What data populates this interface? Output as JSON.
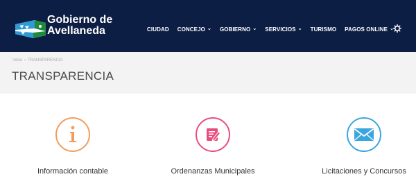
{
  "logo": {
    "line1": "Gobierno de",
    "line2": "Avellaneda"
  },
  "nav": {
    "items": [
      {
        "label": "CIUDAD",
        "dropdown": false
      },
      {
        "label": "CONCEJO",
        "dropdown": true
      },
      {
        "label": "GOBIERNO",
        "dropdown": true
      },
      {
        "label": "SERVICIOS",
        "dropdown": true
      },
      {
        "label": "TURISMO",
        "dropdown": false
      },
      {
        "label": "PAGOS ONLINE",
        "dropdown": true
      }
    ],
    "settings_icon": "gear-icon"
  },
  "breadcrumb": {
    "home": "Inicio",
    "current": "TRANSPARENCIA"
  },
  "page_title": "TRANSPARENCIA",
  "cards": [
    {
      "label": "Información contable",
      "icon": "info-icon",
      "color": "#f39c5a"
    },
    {
      "label": "Ordenanzas Municipales",
      "icon": "document-edit-icon",
      "color": "#e94c7f"
    },
    {
      "label": "Licitaciones y Concursos",
      "icon": "envelope-icon",
      "color": "#3aa6df"
    }
  ],
  "colors": {
    "topbar": "#0d1e44",
    "header_band": "#f3f3f3"
  }
}
